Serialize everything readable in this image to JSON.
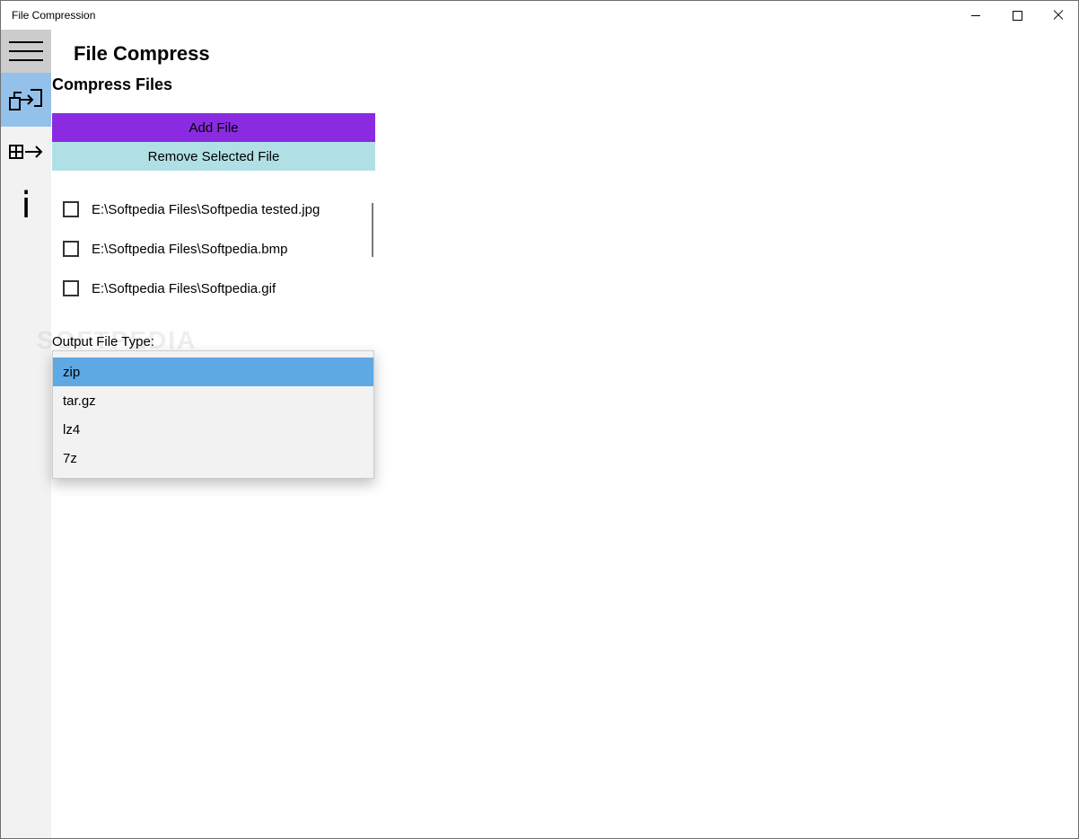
{
  "window": {
    "title": "File Compression",
    "controls": [
      "minimize-icon",
      "maximize-icon",
      "close-icon"
    ]
  },
  "nav": {
    "items": [
      {
        "name": "hamburger-menu",
        "icon": "hamburger-icon",
        "selected": false
      },
      {
        "name": "compress",
        "icon": "compress-icon",
        "selected": true
      },
      {
        "name": "decompress",
        "icon": "decompress-icon",
        "selected": false
      },
      {
        "name": "info",
        "icon": "info-icon",
        "glyph": "i",
        "selected": false
      }
    ]
  },
  "header": {
    "app_title": "File Compress",
    "section_title": "Compress Files"
  },
  "actions": {
    "add_label": "Add File",
    "remove_label": "Remove Selected File"
  },
  "files": [
    {
      "path": "E:\\Softpedia Files\\Softpedia tested.jpg",
      "checked": false
    },
    {
      "path": "E:\\Softpedia Files\\Softpedia.bmp",
      "checked": false
    },
    {
      "path": "E:\\Softpedia Files\\Softpedia.gif",
      "checked": false
    }
  ],
  "output": {
    "label": "Output File Type:",
    "options": [
      "zip",
      "tar.gz",
      "lz4",
      "7z"
    ],
    "selected": "zip"
  },
  "watermark": "SOFTPEDIA",
  "colors": {
    "add_button": "#8a2be2",
    "remove_button": "#b0e0e6",
    "nav_selected": "#94c1ea",
    "nav_hamburger_bg": "#cccccc",
    "nav_bg": "#f2f2f2",
    "dropdown_selected": "#5ea8e4",
    "dropdown_bg": "#f2f2f2"
  }
}
